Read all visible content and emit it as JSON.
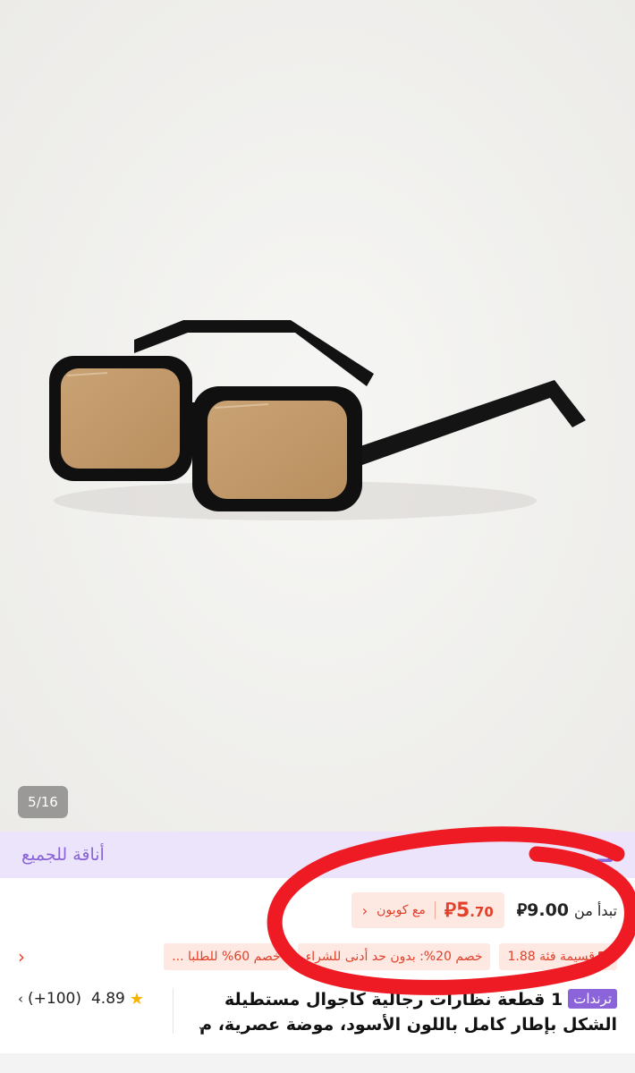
{
  "gallery": {
    "counter": "5/16"
  },
  "promo_banner": {
    "text": "أناقة للجميع",
    "glyph": "تـ"
  },
  "price": {
    "starts_from_label": "تبدأ من",
    "starts_from_value": "9.00",
    "currency_symbol": "⃁",
    "coupon_price_main": "5",
    "coupon_price_decimal": ".70",
    "coupon_label": "مع كوبون"
  },
  "promos": [
    {
      "text": "قسيمة فئة 1.88"
    },
    {
      "text": "خصم 20%: بدون حد أدنى للشراء"
    },
    {
      "text": "خصم 60% للطلبا ..."
    }
  ],
  "product": {
    "badge": "ترندات",
    "title": "1 قطعة نظارات رجالية كاجوال مستطيلة الشكل بإطار كامل باللون الأسود، موضة عصرية، م"
  },
  "rating": {
    "score": "4.89",
    "reviews": "(+100)"
  }
}
